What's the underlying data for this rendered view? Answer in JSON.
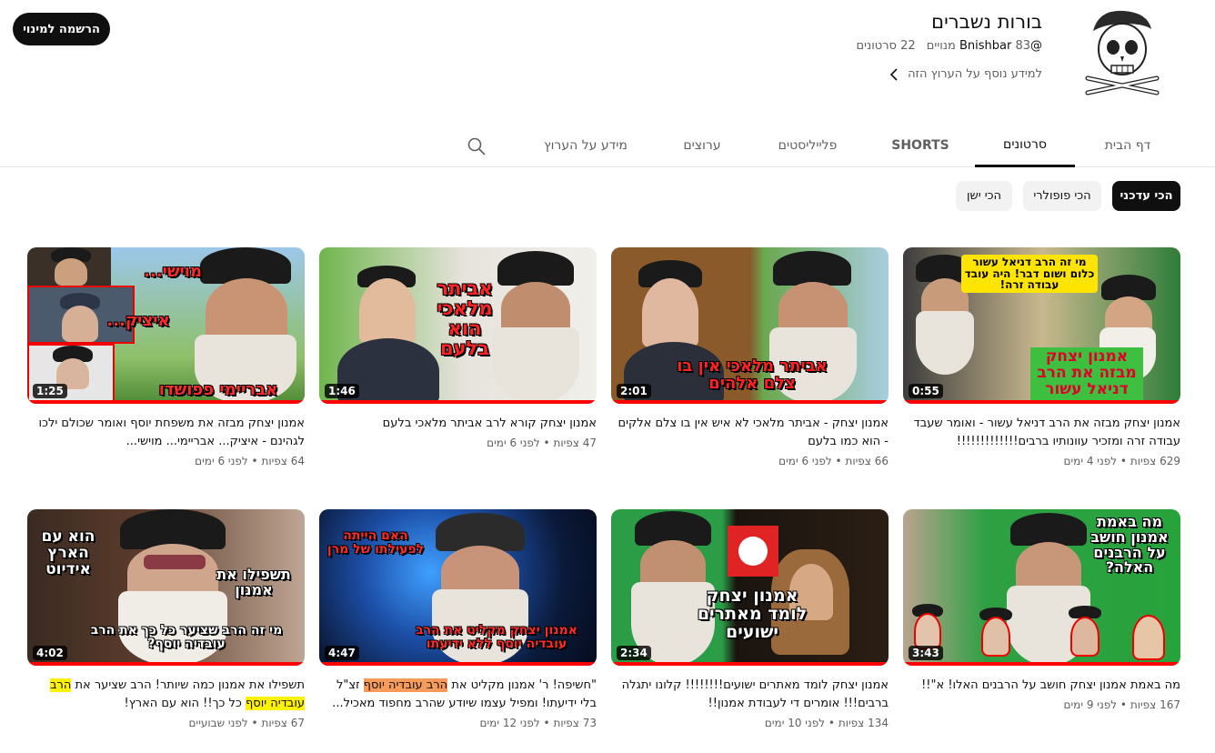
{
  "header": {
    "subscribe_label": "הרשמה למינוי",
    "channel_name": "בורות נשברים",
    "handle": "@Bnishbar",
    "subscribers": "83 מנויים",
    "videos_count": "22 סרטונים",
    "more_info": "למידע נוסף על הערוץ הזה"
  },
  "tabs": {
    "home": "דף הבית",
    "videos": "סרטונים",
    "shorts": "SHORTS",
    "playlists": "פלייליסטים",
    "channels": "ערוצים",
    "about": "מידע על הערוץ"
  },
  "chips": {
    "latest": "הכי עדכני",
    "popular": "הכי פופולרי",
    "oldest": "הכי ישן"
  },
  "videos": [
    {
      "title": "אמנון יצחק מבזה את הרב דניאל עשור - ואומר שעבד עבודה זרה ומזכיר עוונותיו ברבים!!!!!!!!!!!!!",
      "views": "629 צפיות",
      "age": "לפני 4 ימים",
      "duration": "0:55",
      "overlay_top": "מי זה הרב דניאל עשור כלום ושום דבר! היה עובד עבודה זרה!",
      "overlay_bottom": "אמנון יצחק מבזה את הרב דניאל עשור"
    },
    {
      "title": "אמנון יצחק - אביתר מלאכי לא איש אין בו צלם אלקים - הוא כמו בלעם",
      "views": "66 צפיות",
      "age": "לפני 6 ימים",
      "duration": "2:01",
      "overlay_bottom": "אביתר מלאכי אין בו צלם אלהים"
    },
    {
      "title": "אמנון יצחק קורא לרב אביתר מלאכי בלעם",
      "views": "47 צפיות",
      "age": "לפני 6 ימים",
      "duration": "1:46",
      "overlay_top": "אביתר מלאכי הוא בלעם"
    },
    {
      "title": "אמנון יצחק מבזה את משפחת יוסף ואומר שכולם ילכו לגהינם - איציק... אבריימי... מוישי...",
      "views": "64 צפיות",
      "age": "לפני 6 ימים",
      "duration": "1:25",
      "overlay_a": "מוישי...",
      "overlay_b": "איציק...",
      "overlay_bottom": "אבריימי פפושדו"
    },
    {
      "title": "מה באמת אמנון יצחק חושב על הרבנים האלו! א\"!!",
      "views": "167 צפיות",
      "age": "לפני 9 ימים",
      "duration": "3:43",
      "overlay_top": "מה באמת אמנון חושב על הרבנים האלה?"
    },
    {
      "title": "אמנון יצחק לומד מאתרים ישועים!!!!!!!! קלונו יתגלה ברבים!!! אומרים די לעבודת אמנון!!",
      "views": "134 צפיות",
      "age": "לפני 10 ימים",
      "duration": "2:34",
      "overlay_bottom": "אמנון יצחק לומד מאתרים ישועים"
    },
    {
      "title_pre": "\"חשיפה! ר' אמנון מקליט את ",
      "title_hl1": "הרב עובדיה יוסף",
      "title_post": " זצ\"ל בלי ידיעתו! ומפיל עצמו שיודע שהרב מחפוד מאכיל...",
      "views": "73 צפיות",
      "age": "לפני 12 ימים",
      "duration": "4:47",
      "overlay_top": "האם הייתה לפעילתו של מרן",
      "overlay_bottom": "אמנון יצחק מקליט את הרב עובדיה יוסף ללא ידיעתו"
    },
    {
      "title_pre": "תשפילו את אמנון כמה שיותר! הרב שציער את ",
      "title_hl1": "הרב",
      "title_mid": " ",
      "title_hl2": "עובדיה יוסף",
      "title_post": " כל כך!! הוא עם הארץ!",
      "views": "67 צפיות",
      "age": "לפני שבועיים",
      "duration": "4:02",
      "overlay_top": "הוא עם הארץ אידיוט",
      "overlay_mid": "תשפילו את אמנון",
      "overlay_bottom": "מי זה הרב שציער כל כך את הרב עובדיה יוסף?"
    }
  ]
}
